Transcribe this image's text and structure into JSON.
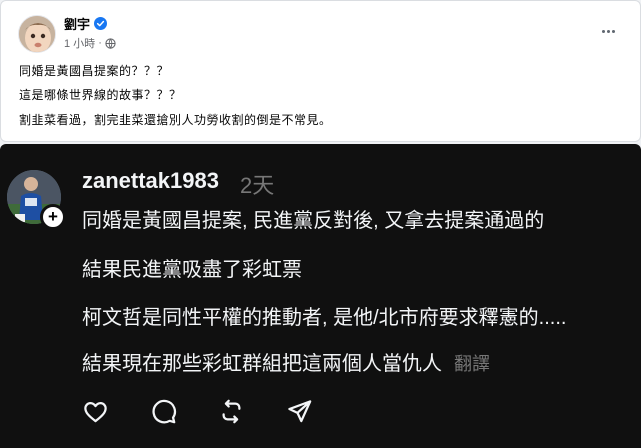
{
  "facebook_post": {
    "author": "劉宇",
    "time": "1 小時",
    "separator": "·",
    "lines": [
      "同婚是黃國昌提案的？？？",
      "這是哪條世界線的故事？？？",
      "割韭菜看過，割完韭菜還搶別人功勞收割的倒是不常見。"
    ],
    "icons": {
      "verified": "verified-badge-icon",
      "audience": "globe-icon",
      "more": "more-options-icon"
    },
    "colors": {
      "verified": "#1877f2",
      "meta": "#65676b"
    }
  },
  "threads_post": {
    "username": "zanettak1983",
    "time": "2天",
    "lines": [
      "同婚是黃國昌提案, 民進黨反對後, 又拿去提案通過的",
      "結果民進黨吸盡了彩虹票",
      "柯文哲是同性平權的推動者, 是他/北市府要求釋憲的.....",
      "結果現在那些彩虹群組把這兩個人當仇人"
    ],
    "translate_label": "翻譯",
    "follow_symbol": "+",
    "icons": [
      "heart-icon",
      "comment-icon",
      "repost-icon",
      "share-icon"
    ],
    "colors": {
      "background": "#101010",
      "text": "#f3f5f7",
      "secondary": "#777777"
    }
  }
}
